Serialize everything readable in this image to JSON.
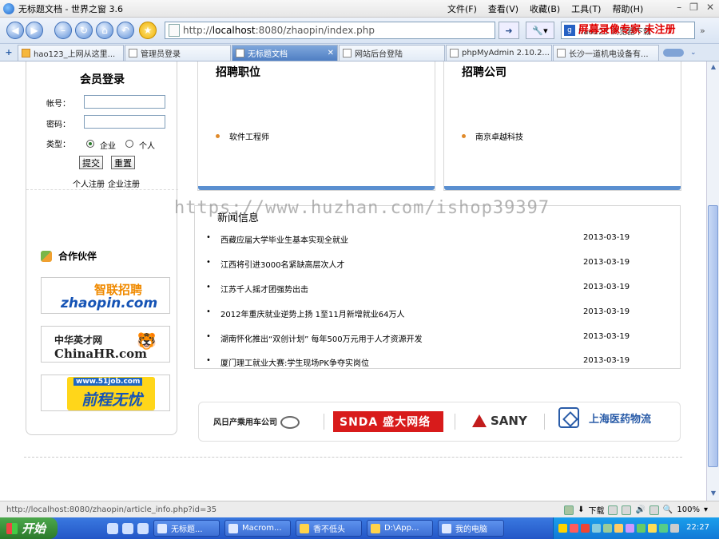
{
  "window": {
    "title": "无标题文档 - 世界之窗 3.6"
  },
  "menu": [
    "文件(F)",
    "查看(V)",
    "收藏(B)",
    "工具(T)",
    "帮助(H)"
  ],
  "address": {
    "url_prefix": "http://",
    "url_host": "localhost",
    "url_rest": ":8080/zhaopin/index.php"
  },
  "search": {
    "label": "hao123 浏览器下载"
  },
  "overlay_watermark_top": "屏幕录像专家  未注册",
  "overlay_watermark_mid": "https://www.huzhan.com/ishop39397",
  "tabs": [
    {
      "label": "hao123_上网从这里...",
      "active": false
    },
    {
      "label": "管理员登录",
      "active": false
    },
    {
      "label": "无标题文档",
      "active": true
    },
    {
      "label": "网站后台登陆",
      "active": false
    },
    {
      "label": "phpMyAdmin 2.10.2...",
      "active": false
    },
    {
      "label": "长沙一道机电设备有...",
      "active": false
    }
  ],
  "login": {
    "title": "会员登录",
    "account_label": "帐号：",
    "password_label": "密码：",
    "type_label": "类型：",
    "type_options": [
      "企业",
      "个人"
    ],
    "type_selected": "企业",
    "submit": "提交",
    "reset": "重置",
    "reg_person": "个人注册",
    "reg_company": "企业注册"
  },
  "partners": {
    "title": "合作伙伴",
    "logos": [
      {
        "zh": "智联招聘",
        "en": "zhaopin.com"
      },
      {
        "zh": "中华英才网",
        "en": "ChinaHR.com"
      },
      {
        "site": "www.51job.com",
        "zh": "前程无忧"
      }
    ]
  },
  "jobs": {
    "title": "招聘职位",
    "items": [
      "软件工程师"
    ]
  },
  "companies": {
    "title": "招聘公司",
    "items": [
      "南京卓越科技"
    ]
  },
  "news": {
    "title": "新闻信息",
    "items": [
      {
        "title": "西藏应届大学毕业生基本实现全就业",
        "date": "2013-03-19"
      },
      {
        "title": "江西将引进3000名紧缺高层次人才",
        "date": "2013-03-19"
      },
      {
        "title": "江苏千人摇才团强势出击",
        "date": "2013-03-19"
      },
      {
        "title": "2012年重庆就业逆势上扬 1至11月新增就业64万人",
        "date": "2013-03-19"
      },
      {
        "title": "湖南怀化推出“双创计划” 每年500万元用于人才资源开发",
        "date": "2013-03-19"
      },
      {
        "title": "厦门理工就业大赛:学生现场PK争夺实岗位",
        "date": "2013-03-19"
      }
    ]
  },
  "sponsors": {
    "nissan": "风日产乘用车公司",
    "snda": "SNDA 盛大网络",
    "sany": "SANY",
    "shaphar": "上海医药物流"
  },
  "status": {
    "text": "http://localhost:8080/zhaopin/article_info.php?id=35",
    "download": "下载",
    "zoom": "100%"
  },
  "taskbar": {
    "start": "开始",
    "buttons": [
      "无标题...",
      "Macrom...",
      "香不低头",
      "D:\\App...",
      "我的电脑"
    ],
    "clock": "22:27"
  }
}
